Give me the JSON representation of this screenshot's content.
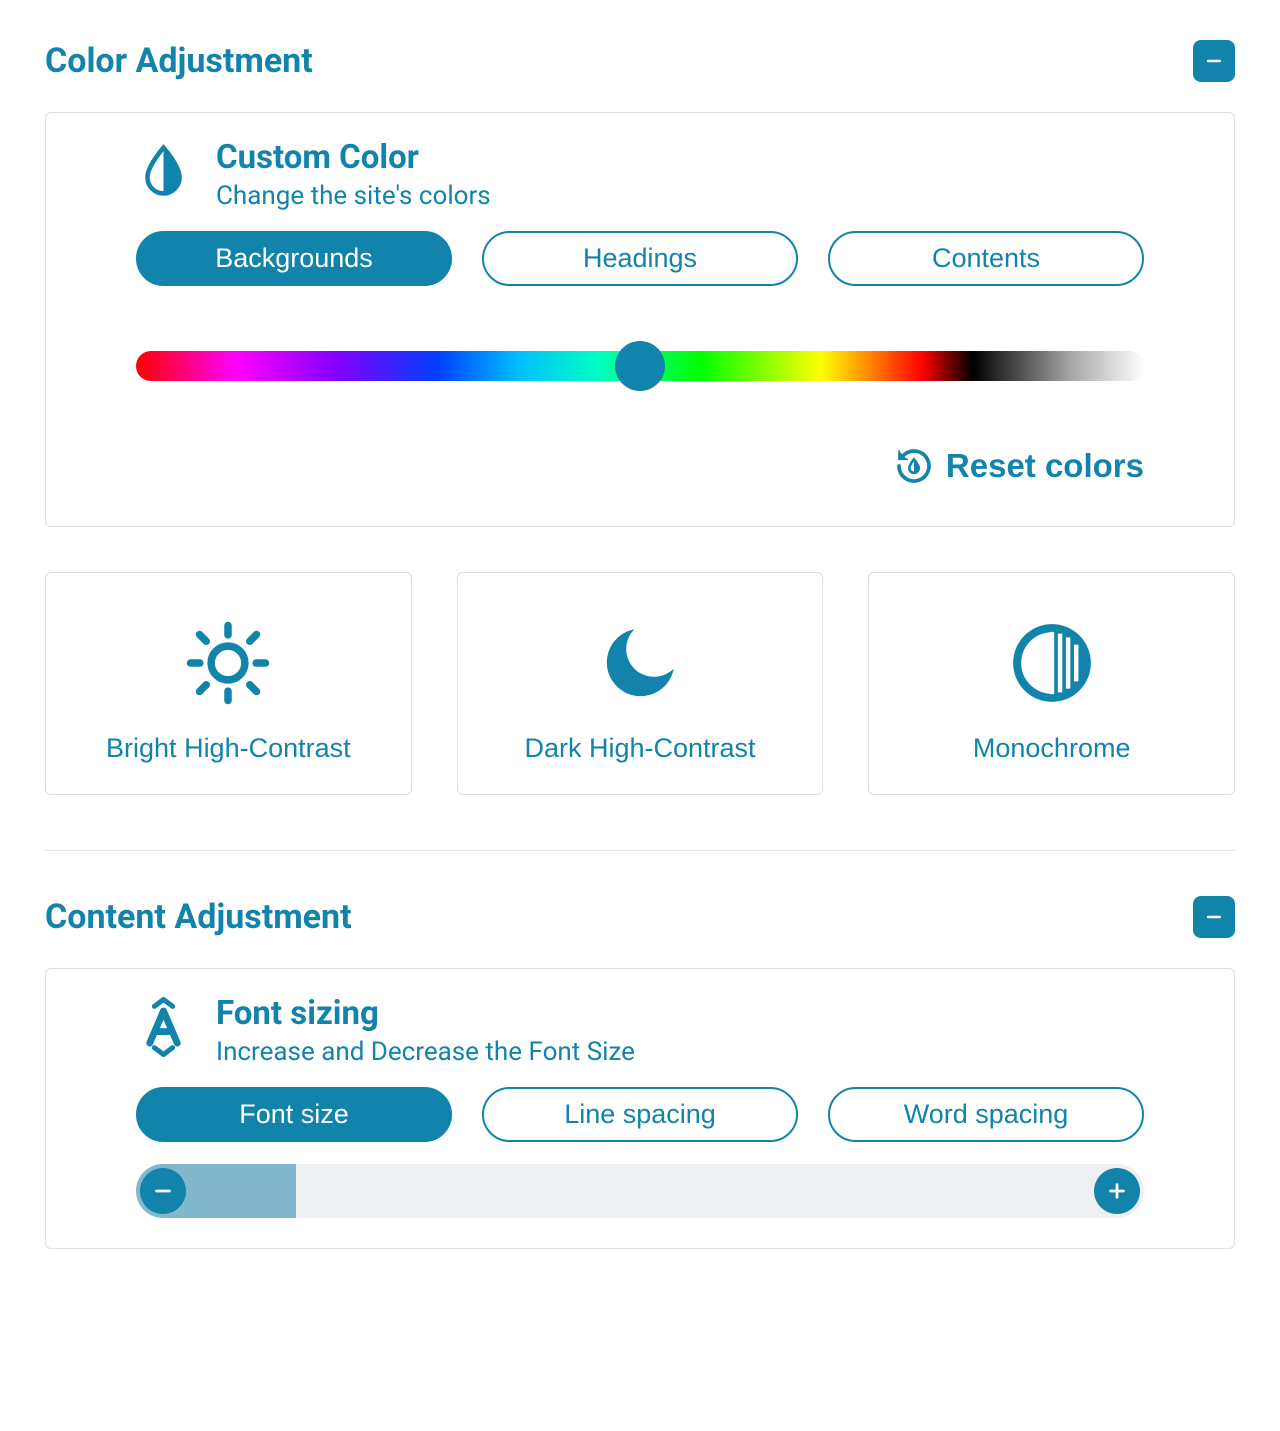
{
  "color_section": {
    "title": "Color Adjustment",
    "custom": {
      "title": "Custom Color",
      "subtitle": "Change the site's colors",
      "tabs": [
        "Backgrounds",
        "Headings",
        "Contents"
      ],
      "active_tab_index": 0,
      "slider_percent": 50,
      "reset_label": "Reset colors"
    },
    "presets": [
      {
        "label": "Bright High-Contrast",
        "icon": "sun"
      },
      {
        "label": "Dark High-Contrast",
        "icon": "moon"
      },
      {
        "label": "Monochrome",
        "icon": "half-circle"
      }
    ]
  },
  "content_section": {
    "title": "Content Adjustment",
    "font": {
      "title": "Font sizing",
      "subtitle": "Increase and Decrease the Font Size",
      "tabs": [
        "Font size",
        "Line spacing",
        "Word spacing"
      ],
      "active_tab_index": 0
    }
  },
  "colors": {
    "accent": "#1283ab"
  }
}
